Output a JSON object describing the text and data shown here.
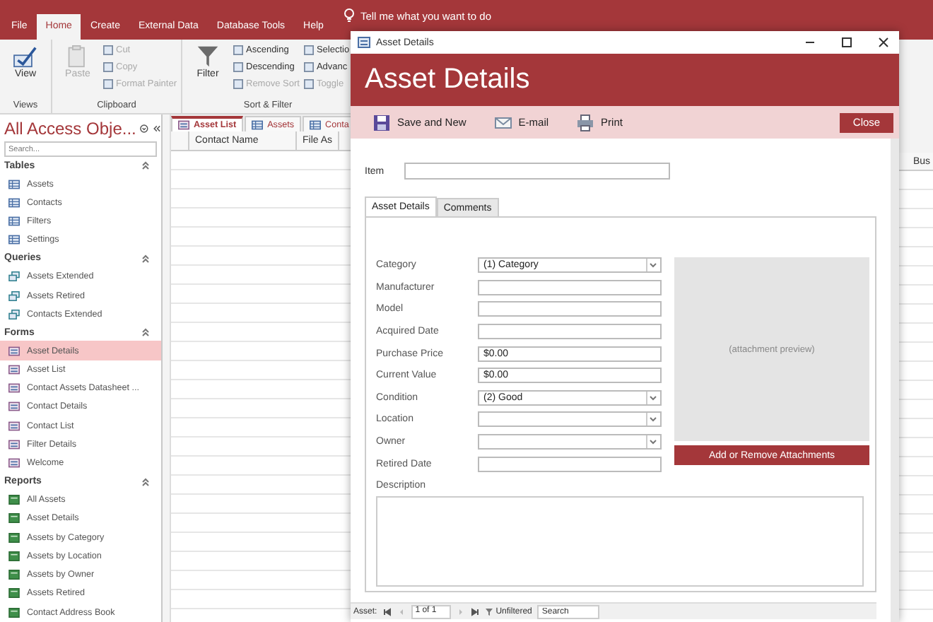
{
  "ribbon_tabs": [
    {
      "label": "File",
      "selected": false
    },
    {
      "label": "Home",
      "selected": true
    },
    {
      "label": "Create",
      "selected": false
    },
    {
      "label": "External Data",
      "selected": false
    },
    {
      "label": "Database Tools",
      "selected": false
    },
    {
      "label": "Help",
      "selected": false
    }
  ],
  "tell_me": "Tell me what you want to do",
  "ribbon_groups": [
    {
      "label": "Views",
      "large": [
        {
          "label": "View",
          "kind": "view",
          "disabled": false
        }
      ]
    },
    {
      "label": "Clipboard",
      "large": [
        {
          "label": "Paste",
          "kind": "paste",
          "disabled": true
        }
      ],
      "columns": [
        [
          {
            "label": "Cut",
            "disabled": true
          },
          {
            "label": "Copy",
            "disabled": true
          },
          {
            "label": "Format Painter",
            "disabled": true
          }
        ]
      ]
    },
    {
      "label": "Sort & Filter",
      "large": [
        {
          "label": "Filter",
          "kind": "filter",
          "disabled": false
        }
      ],
      "columns": [
        [
          {
            "label": "Ascending",
            "disabled": false
          },
          {
            "label": "Descending",
            "disabled": false
          },
          {
            "label": "Remove Sort",
            "disabled": true
          }
        ],
        [
          {
            "label": "Selectio",
            "disabled": false
          },
          {
            "label": "Advanc",
            "disabled": false
          },
          {
            "label": "Toggle",
            "disabled": true
          }
        ]
      ]
    }
  ],
  "nav_pane": {
    "title": "All Access Obje...",
    "search_placeholder": "Search...",
    "groups": [
      {
        "label": "Tables",
        "kind": "table",
        "items": [
          {
            "label": "Assets",
            "selected": false
          },
          {
            "label": "Contacts",
            "selected": false
          },
          {
            "label": "Filters",
            "selected": false
          },
          {
            "label": "Settings",
            "selected": false
          }
        ]
      },
      {
        "label": "Queries",
        "kind": "query",
        "items": [
          {
            "label": "Assets Extended",
            "selected": false
          },
          {
            "label": "Assets Retired",
            "selected": false
          },
          {
            "label": "Contacts Extended",
            "selected": false
          }
        ]
      },
      {
        "label": "Forms",
        "kind": "form",
        "items": [
          {
            "label": "Asset Details",
            "selected": true
          },
          {
            "label": "Asset List",
            "selected": false
          },
          {
            "label": "Contact Assets Datasheet ...",
            "selected": false
          },
          {
            "label": "Contact Details",
            "selected": false
          },
          {
            "label": "Contact List",
            "selected": false
          },
          {
            "label": "Filter Details",
            "selected": false
          },
          {
            "label": "Welcome",
            "selected": false
          }
        ]
      },
      {
        "label": "Reports",
        "kind": "report",
        "items": [
          {
            "label": "All Assets",
            "selected": false
          },
          {
            "label": "Asset Details",
            "selected": false
          },
          {
            "label": "Assets by Category",
            "selected": false
          },
          {
            "label": "Assets by Location",
            "selected": false
          },
          {
            "label": "Assets by Owner",
            "selected": false
          },
          {
            "label": "Assets Retired",
            "selected": false
          },
          {
            "label": "Contact Address Book",
            "selected": false
          }
        ]
      }
    ]
  },
  "document_tabs": [
    {
      "label": "Asset List",
      "kind": "form",
      "selected": true
    },
    {
      "label": "Assets",
      "kind": "table",
      "selected": false
    },
    {
      "label": "Conta",
      "kind": "table",
      "selected": false
    }
  ],
  "datasheet": {
    "columns": [
      "Contact Name",
      "File As"
    ],
    "right_column": "Bus"
  },
  "popup": {
    "window_title": "Asset Details",
    "header": "Asset Details",
    "toolbar": [
      {
        "label": "Save and New",
        "kind": "save"
      },
      {
        "label": "E-mail",
        "kind": "email"
      },
      {
        "label": "Print",
        "kind": "print"
      }
    ],
    "close_button": "Close",
    "item_label": "Item",
    "tabs": [
      {
        "label": "Asset Details",
        "selected": true
      },
      {
        "label": "Comments",
        "selected": false
      }
    ],
    "fields": [
      {
        "label": "Category",
        "kind": "combo",
        "value": "(1) Category"
      },
      {
        "label": "Manufacturer",
        "kind": "text"
      },
      {
        "label": "Model",
        "kind": "text"
      },
      {
        "label": "Acquired Date",
        "kind": "text"
      },
      {
        "label": "Purchase Price",
        "kind": "text",
        "value": "$0.00"
      },
      {
        "label": "Current Value",
        "kind": "text",
        "value": "$0.00"
      },
      {
        "label": "Condition",
        "kind": "combo",
        "value": "(2) Good"
      },
      {
        "label": "Location",
        "kind": "combo"
      },
      {
        "label": "Owner",
        "kind": "combo"
      },
      {
        "label": "Retired Date",
        "kind": "text"
      }
    ],
    "attachment_preview": "(attachment preview)",
    "attachment_button": "Add or Remove Attachments",
    "description_label": "Description",
    "status": {
      "record_label": "Asset:",
      "position": "1 of 1",
      "filter": "Unfiltered",
      "search_placeholder": "Search"
    }
  }
}
